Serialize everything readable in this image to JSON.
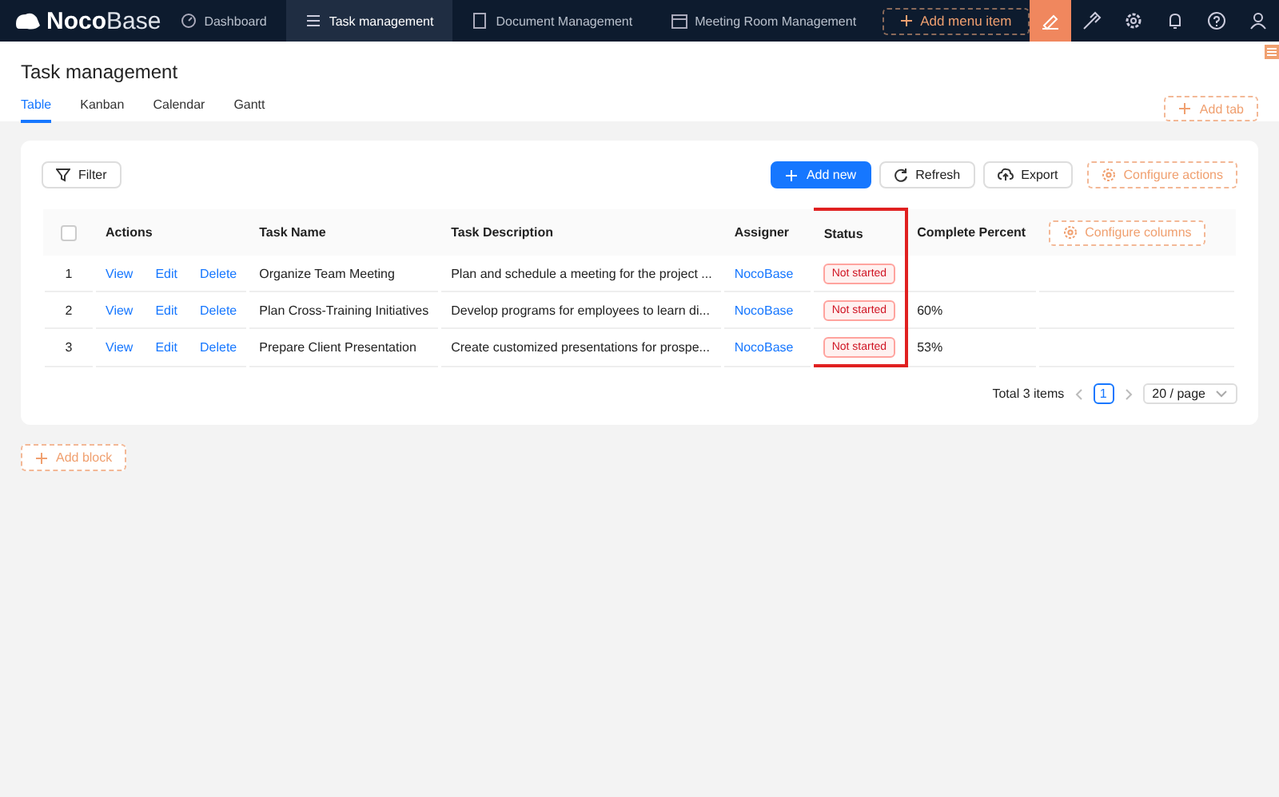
{
  "topbar": {
    "logo_bold": "Noco",
    "logo_light": "Base",
    "menu": [
      {
        "label": "Dashboard",
        "kind": "dashboard",
        "selected": false
      },
      {
        "label": "Task management",
        "kind": "list",
        "selected": true
      },
      {
        "label": "Document Management",
        "kind": "doc",
        "selected": false
      },
      {
        "label": "Meeting Room Management",
        "kind": "calendar",
        "selected": false
      }
    ],
    "add_menu_item": "Add menu item"
  },
  "page": {
    "title": "Task management",
    "tabs": [
      {
        "label": "Table",
        "selected": true
      },
      {
        "label": "Kanban",
        "selected": false
      },
      {
        "label": "Calendar",
        "selected": false
      },
      {
        "label": "Gantt",
        "selected": false
      }
    ],
    "add_tab": "Add tab"
  },
  "toolbar": {
    "filter": "Filter",
    "add_new": "Add new",
    "refresh": "Refresh",
    "export": "Export",
    "configure_actions": "Configure actions"
  },
  "table": {
    "select_all_checked": false,
    "columns": [
      {
        "label": "Actions",
        "highlighted": false
      },
      {
        "label": "Task Name",
        "highlighted": false
      },
      {
        "label": "Task Description",
        "highlighted": false
      },
      {
        "label": "Assigner",
        "highlighted": false
      },
      {
        "label": "Status",
        "highlighted": true
      },
      {
        "label": "Complete Percent",
        "highlighted": false
      }
    ],
    "configure_columns": "Configure columns",
    "rows": [
      {
        "index": "1",
        "actions": [
          "View",
          "Edit",
          "Delete"
        ],
        "task_name": "Organize Team Meeting",
        "description": "Plan and schedule a meeting for the project ...",
        "assigner": "NocoBase",
        "status": "Not started"
      },
      {
        "index": "2",
        "actions": [
          "View",
          "Edit",
          "Delete"
        ],
        "task_name": "Plan Cross-Training Initiatives",
        "description": "Develop programs for employees to learn di...",
        "assigner": "NocoBase",
        "status": "Not started",
        "percent": "60%"
      },
      {
        "index": "3",
        "actions": [
          "View",
          "Edit",
          "Delete"
        ],
        "task_name": "Prepare Client Presentation",
        "description": "Create customized presentations for prospe...",
        "assigner": "NocoBase",
        "status": "Not started",
        "percent": "53%"
      }
    ]
  },
  "pagination": {
    "total": "Total 3 items",
    "pages": [
      {
        "label": "1",
        "selected": true
      }
    ],
    "page_size": "20 / page"
  },
  "add_block": "Add block"
}
